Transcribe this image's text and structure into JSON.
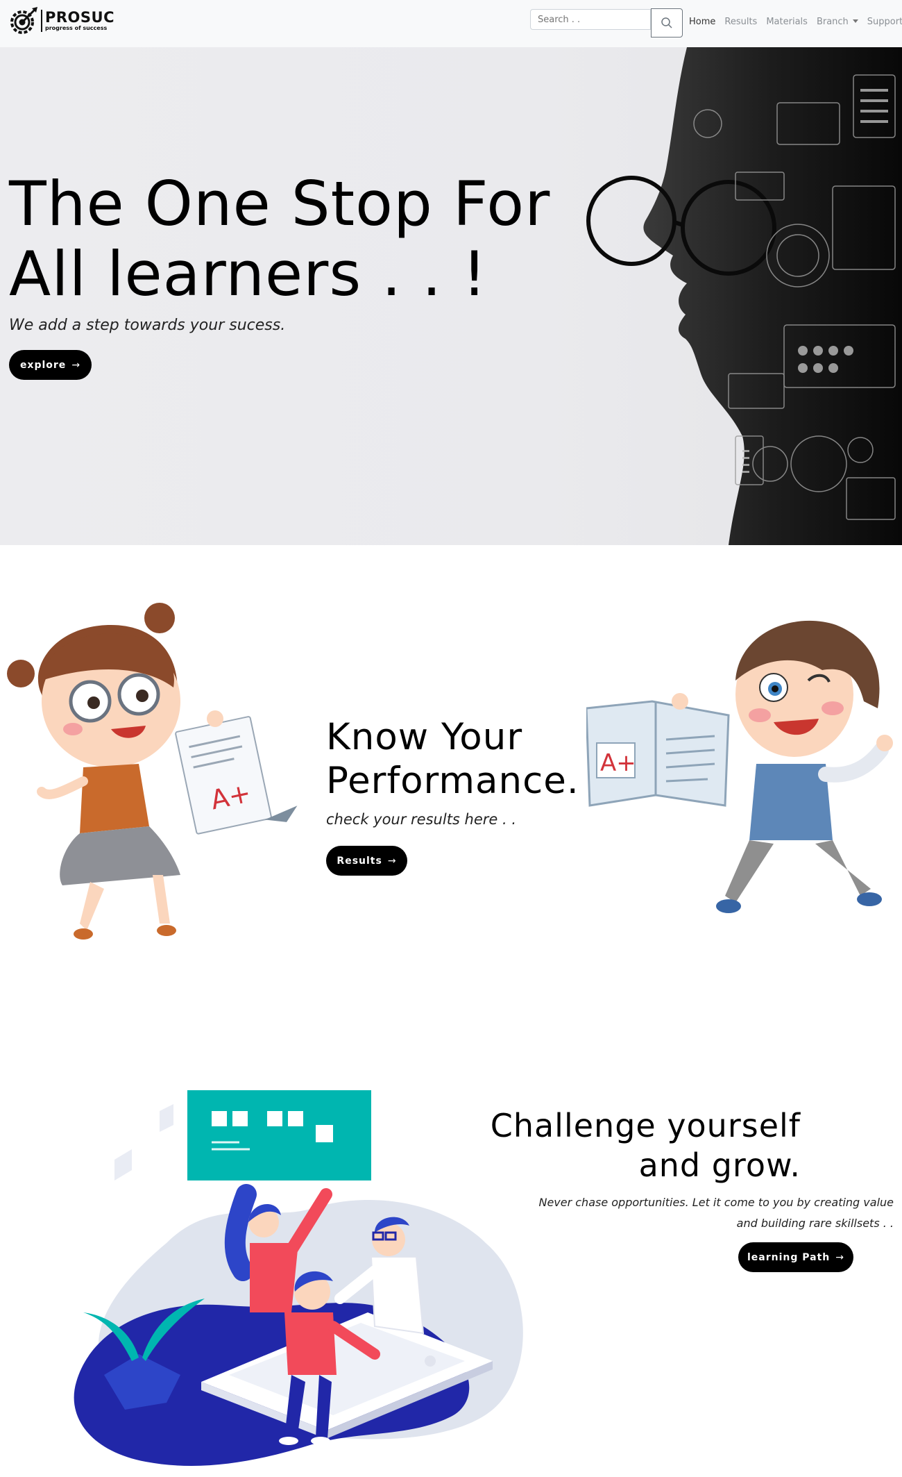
{
  "navbar": {
    "brand_name": "PROSUC",
    "brand_tagline": "progress of success",
    "search": {
      "placeholder": "Search . .",
      "value": ""
    },
    "links": [
      "Home",
      "Results",
      "Materials",
      "Branch",
      "Support"
    ],
    "active_link": "Home"
  },
  "hero": {
    "title_line1": "The One Stop For",
    "title_line2": "All learners . . !",
    "subtitle": "We add a step towards your sucess.",
    "button_label": "explore"
  },
  "performance": {
    "title_line1": "Know Your",
    "title_line2": "Performance.",
    "subtitle": "check your results here . .",
    "button_label": "Results",
    "paper_grade": "A+"
  },
  "challenge": {
    "title_line1": "Challenge yourself",
    "title_line2": "and grow.",
    "subtitle_line1": "Never chase opportunities. Let it come to you by creating value",
    "subtitle_line2": "and building rare skillsets . .",
    "button_label": "learning Path"
  },
  "icons": {
    "search": "search-icon",
    "arrow": "arrow-right-icon",
    "dropdown": "caret-down-icon",
    "logo": "target-gear-icon"
  },
  "colors": {
    "nav_bg": "#f8f9fa",
    "button_bg": "#000000",
    "accent_teal": "#00b6b0",
    "accent_blue": "#2127a8",
    "accent_red": "#f24a5a"
  }
}
